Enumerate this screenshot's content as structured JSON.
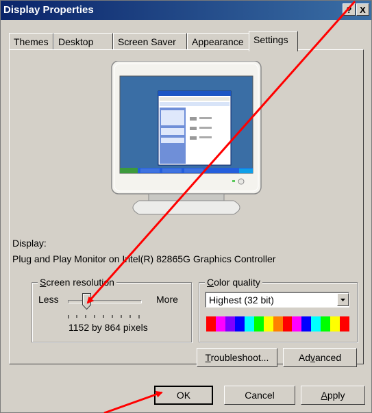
{
  "window": {
    "title": "Display Properties",
    "help_glyph": "?",
    "close_glyph": "X"
  },
  "tabs": [
    {
      "label": "Themes"
    },
    {
      "label": "Desktop"
    },
    {
      "label": "Screen Saver"
    },
    {
      "label": "Appearance"
    },
    {
      "label": "Settings"
    }
  ],
  "active_tab": "Settings",
  "display": {
    "label": "Display:",
    "value": "Plug and Play Monitor on Intel(R) 82865G Graphics Controller"
  },
  "resolution": {
    "group_first": "S",
    "group_rest": "creen resolution",
    "less": "Less",
    "more": "More",
    "value": "1152 by 864 pixels",
    "slider_fraction": 0.25
  },
  "color_quality": {
    "group_first": "C",
    "group_rest": "olor quality",
    "selected": "Highest (32 bit)"
  },
  "buttons": {
    "troubleshoot_first": "T",
    "troubleshoot_rest": "roubleshoot...",
    "advanced_pre": "Ad",
    "advanced_ul": "v",
    "advanced_post": "anced",
    "ok": "OK",
    "cancel": "Cancel",
    "apply_first": "A",
    "apply_rest": "pply"
  },
  "colors": {
    "titlebar_start": "#0a246a",
    "titlebar_end": "#3a6ea5",
    "desktop_blue": "#3a6ea5",
    "annotation_red": "#ff0000"
  },
  "icons": [
    "help-icon",
    "close-icon",
    "monitor-preview",
    "slider-thumb-icon",
    "dropdown-arrow-icon"
  ]
}
